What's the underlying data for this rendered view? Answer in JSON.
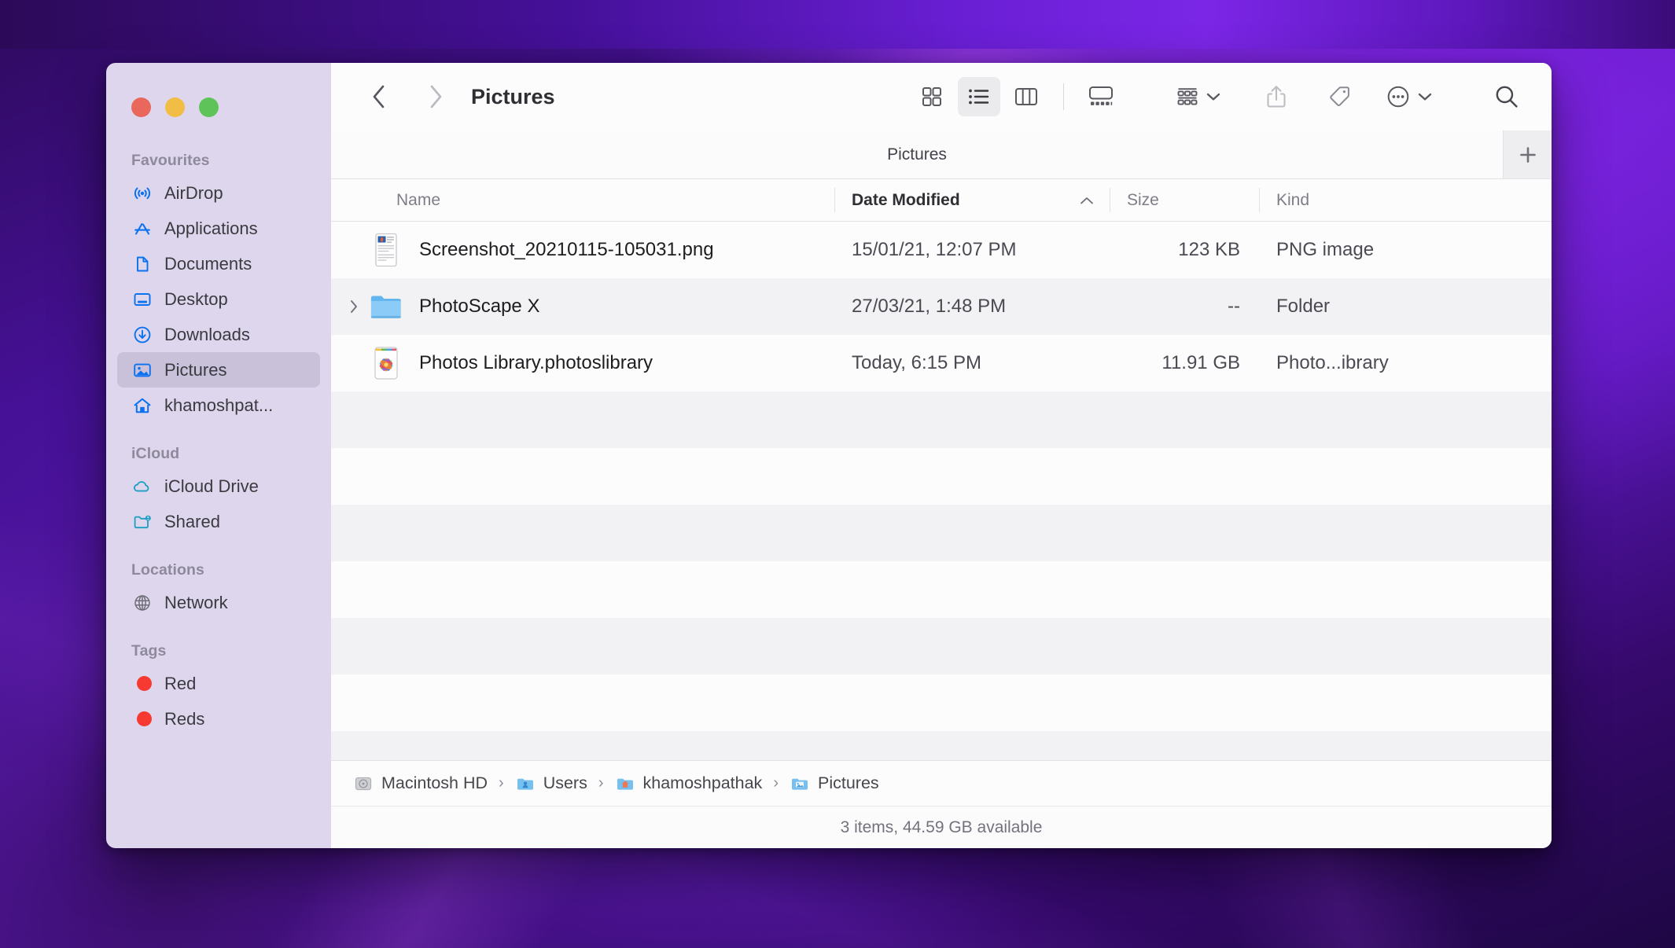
{
  "window": {
    "title": "Pictures",
    "traffic_lights": [
      "close",
      "minimize",
      "maximize"
    ]
  },
  "toolbar": {
    "back_label": "Back",
    "forward_label": "Forward",
    "title": "Pictures",
    "view_icon_label": "Icon view",
    "view_list_label": "List view",
    "view_column_label": "Column view",
    "view_gallery_label": "Gallery view",
    "group_label": "Group",
    "share_label": "Share",
    "tag_label": "Tags",
    "more_label": "More",
    "search_label": "Search"
  },
  "tabbar": {
    "active_tab": "Pictures",
    "add_tab_label": "+"
  },
  "columns": [
    {
      "key": "name",
      "label": "Name",
      "active": false
    },
    {
      "key": "date",
      "label": "Date Modified",
      "active": true,
      "sort": "ascending"
    },
    {
      "key": "size",
      "label": "Size",
      "active": false
    },
    {
      "key": "kind",
      "label": "Kind",
      "active": false
    }
  ],
  "files": [
    {
      "name": "Screenshot_20210115-105031.png",
      "date": "15/01/21, 12:07 PM",
      "size": "123 KB",
      "kind": "PNG image",
      "icon": "png-preview-icon",
      "expandable": false,
      "striped": false
    },
    {
      "name": "PhotoScape X",
      "date": "27/03/21, 1:48 PM",
      "size": "--",
      "kind": "Folder",
      "icon": "folder-icon",
      "expandable": true,
      "striped": true
    },
    {
      "name": "Photos Library.photoslibrary",
      "date": "Today, 6:15 PM",
      "size": "11.91 GB",
      "kind": "Photo...ibrary",
      "icon": "photos-library-icon",
      "expandable": false,
      "striped": false
    }
  ],
  "empty_rows": [
    {
      "striped": true
    },
    {
      "striped": false
    },
    {
      "striped": true
    },
    {
      "striped": false
    },
    {
      "striped": true
    },
    {
      "striped": false
    },
    {
      "striped": true
    }
  ],
  "sidebar": {
    "sections": [
      {
        "title": "Favourites",
        "items": [
          {
            "label": "AirDrop",
            "icon": "airdrop-icon",
            "selected": false
          },
          {
            "label": "Applications",
            "icon": "applications-icon",
            "selected": false
          },
          {
            "label": "Documents",
            "icon": "document-icon",
            "selected": false
          },
          {
            "label": "Desktop",
            "icon": "desktop-icon",
            "selected": false
          },
          {
            "label": "Downloads",
            "icon": "downloads-icon",
            "selected": false
          },
          {
            "label": "Pictures",
            "icon": "pictures-icon",
            "selected": true
          },
          {
            "label": "khamoshpat...",
            "icon": "home-icon",
            "selected": false
          }
        ]
      },
      {
        "title": "iCloud",
        "items": [
          {
            "label": "iCloud Drive",
            "icon": "cloud-icon",
            "selected": false
          },
          {
            "label": "Shared",
            "icon": "shared-folder-icon",
            "selected": false
          }
        ]
      },
      {
        "title": "Locations",
        "items": [
          {
            "label": "Network",
            "icon": "globe-icon",
            "selected": false
          }
        ]
      },
      {
        "title": "Tags",
        "items": [
          {
            "label": "Red",
            "icon": "tag-dot-icon",
            "color": "#f63a32",
            "selected": false
          },
          {
            "label": "Reds",
            "icon": "tag-dot-icon",
            "color": "#f63a32",
            "selected": false
          }
        ]
      }
    ]
  },
  "pathbar": {
    "crumbs": [
      {
        "label": "Macintosh HD",
        "icon": "harddisk-icon"
      },
      {
        "label": "Users",
        "icon": "users-folder-icon"
      },
      {
        "label": "khamoshpathak",
        "icon": "home-folder-icon"
      },
      {
        "label": "Pictures",
        "icon": "pictures-folder-icon"
      }
    ],
    "separator": "›"
  },
  "statusbar": {
    "text": "3 items, 44.59 GB available"
  },
  "colors": {
    "sidebar_bg": "#ded6ec",
    "sidebar_selected": "#c9c0d9",
    "accent_blue": "#007aff",
    "icloud_teal": "#1b9fc4",
    "tag_red": "#f63a32",
    "row_stripe": "#f2f2f4"
  }
}
